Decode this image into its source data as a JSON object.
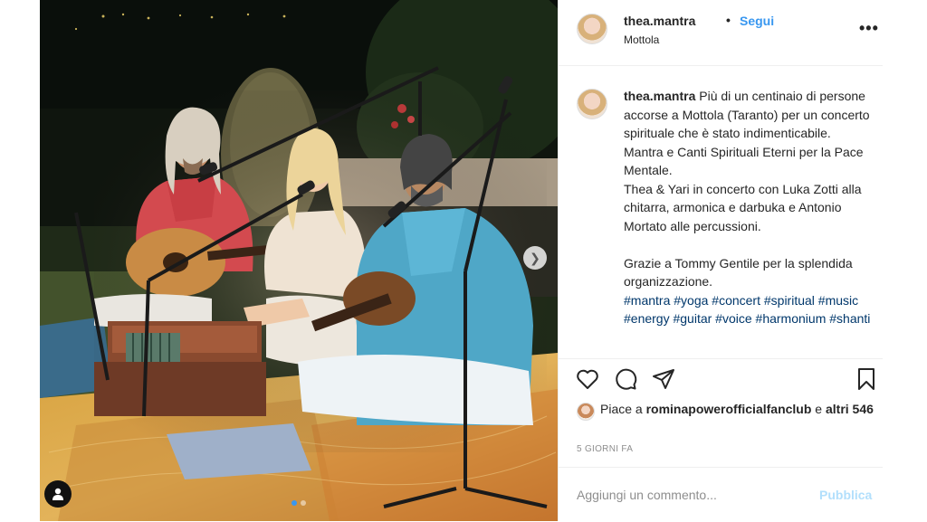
{
  "header": {
    "username": "thea.mantra",
    "separator": "•",
    "follow_label": "Segui",
    "location": "Mottola",
    "more_icon": "more-options-icon"
  },
  "caption": {
    "username": "thea.mantra",
    "paragraphs": [
      "Più di un centinaio di persone accorse a Mottola (Taranto) per un concerto spirituale che è stato indimenticabile.",
      "Mantra e Canti Spirituali Eterni per la Pace Mentale.",
      "Thea & Yari in concerto con Luka Zotti alla chitarra, armonica e darbuka e Antonio Mortato alle percussioni."
    ],
    "thanks": "Grazie a Tommy Gentile per la splendida organizzazione.",
    "hashtags": "#mantra #yoga #concert #spiritual #music #energy #guitar #voice #harmonium #shanti"
  },
  "actions": {
    "icons": [
      "heart-icon",
      "comment-icon",
      "share-icon",
      "bookmark-icon"
    ]
  },
  "likes": {
    "prefix": "Piace a",
    "user": "rominapowerofficialfanclub",
    "conjunction": "e",
    "others": "altri 546"
  },
  "timestamp": "5 GIORNI FA",
  "comment": {
    "placeholder": "Aggiungi un commento...",
    "publish_label": "Pubblica"
  },
  "colors": {
    "link": "#3897f0",
    "hashtag": "#00376b",
    "publish_disabled": "#b2dffc",
    "muted": "#8e8e8e",
    "carousel_active_dot": "#3897f0"
  },
  "carousel": {
    "count": 2,
    "active_index": 0
  }
}
